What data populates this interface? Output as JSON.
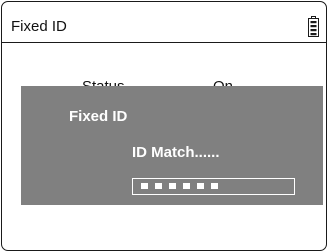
{
  "header": {
    "title": "Fixed ID",
    "battery_icon": "battery-icon"
  },
  "background": {
    "status_label": "Status",
    "status_value": "On"
  },
  "dialog": {
    "title": "Fixed ID",
    "message": "ID Match......",
    "pin_dot_count": 6,
    "background_color": "#808080",
    "text_color": "#ffffff"
  }
}
